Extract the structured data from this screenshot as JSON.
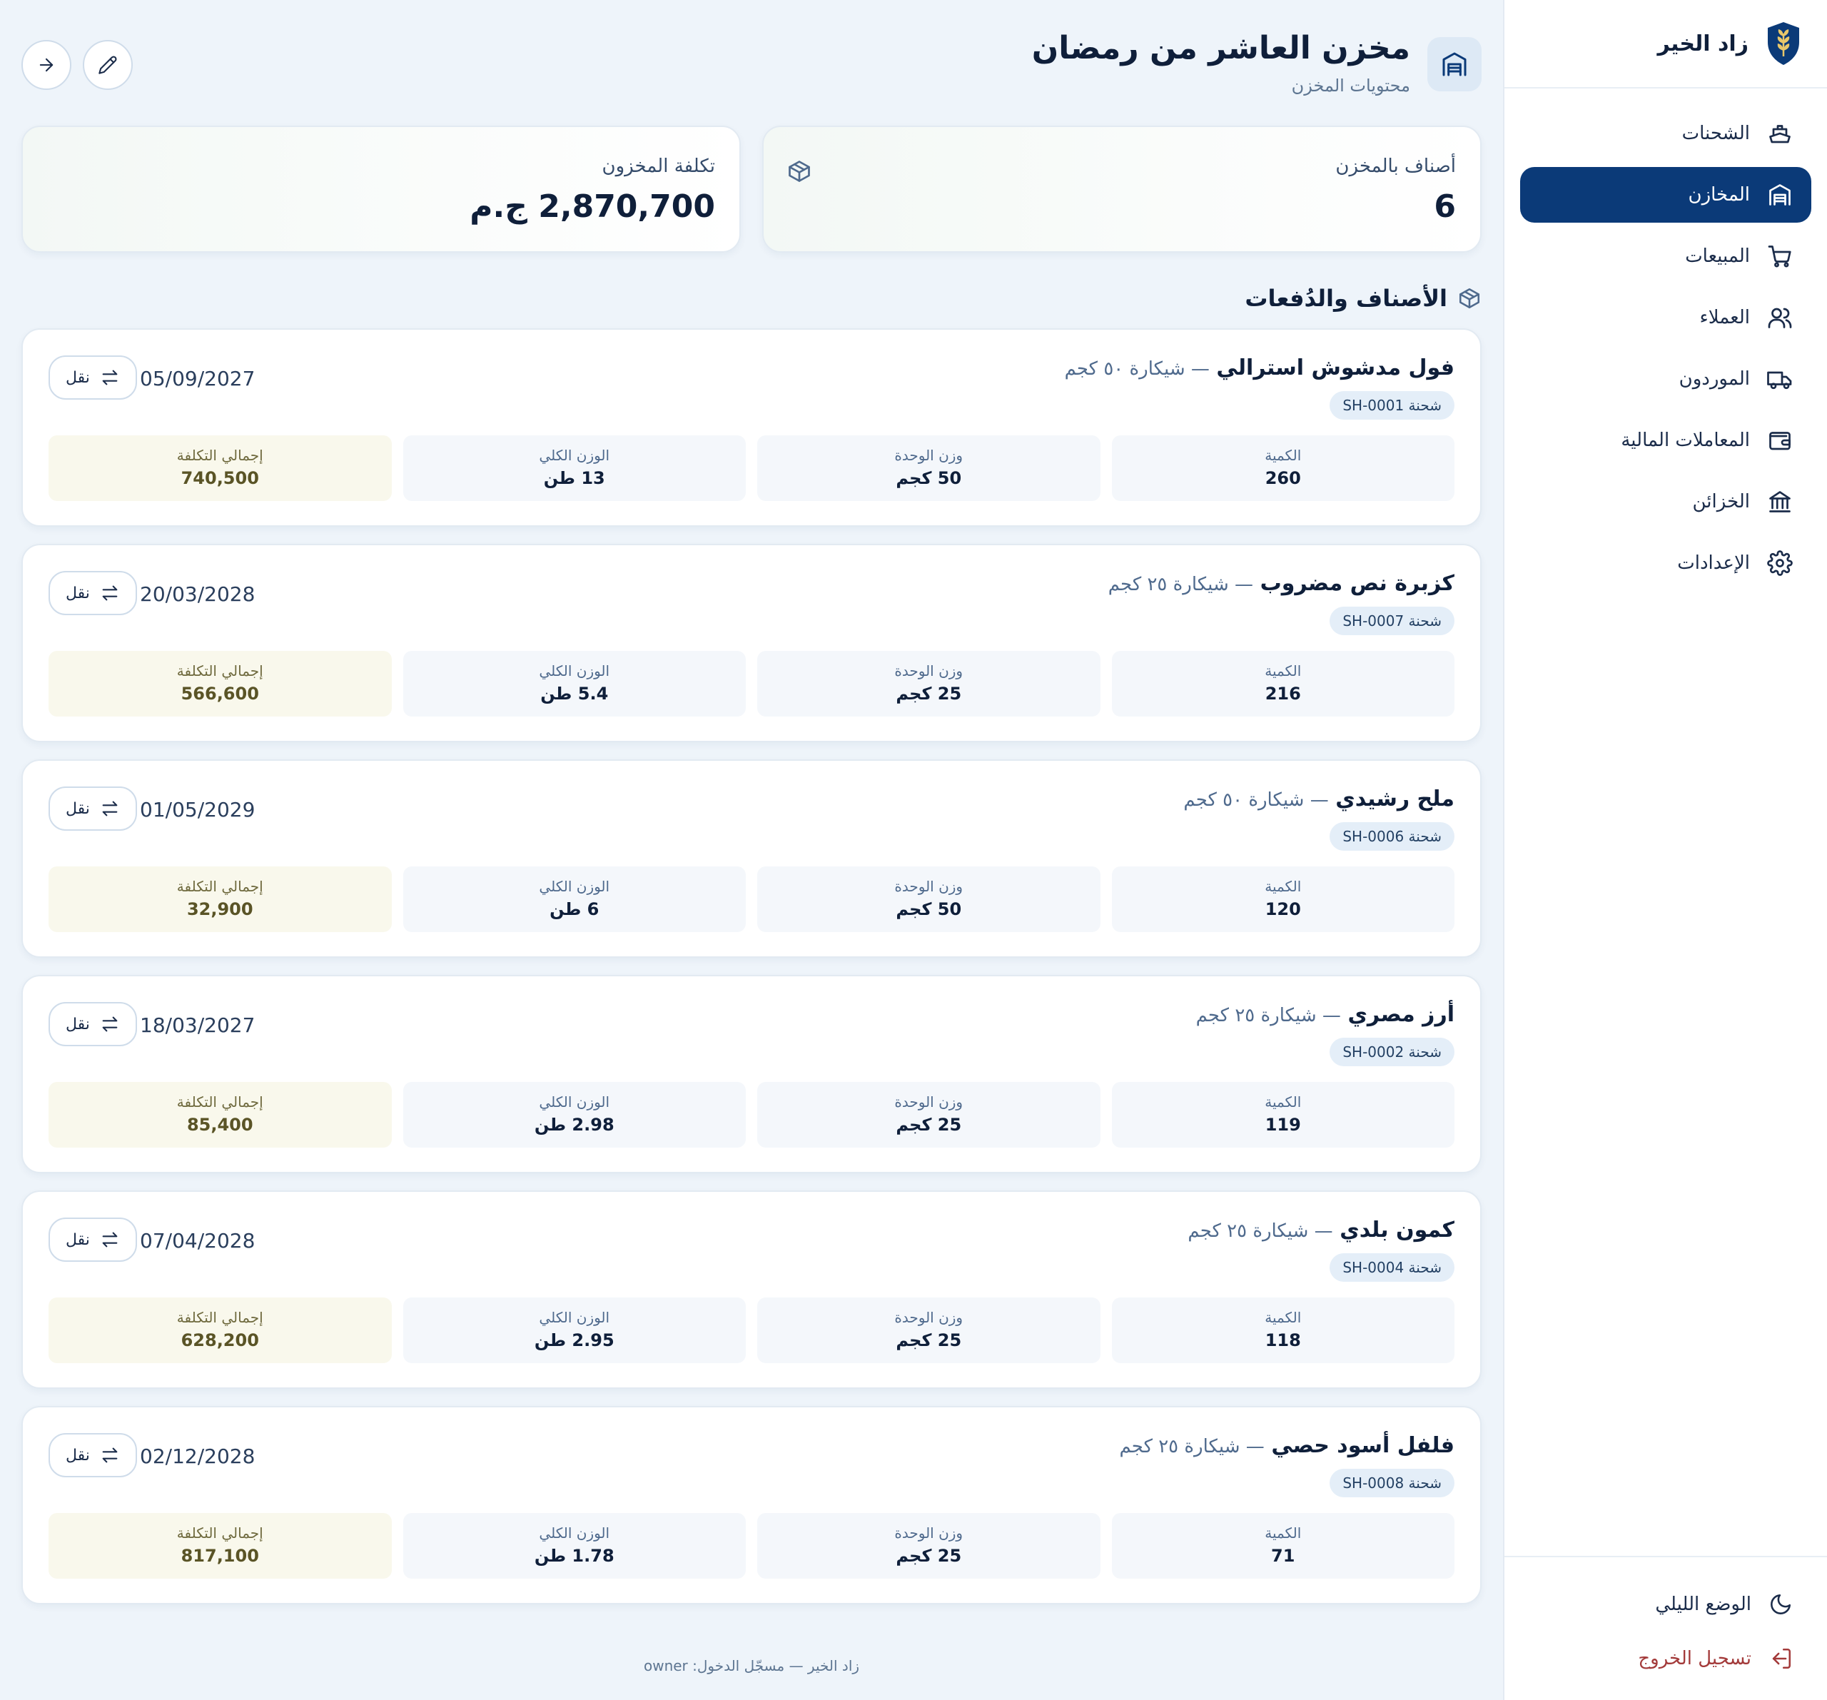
{
  "brand": {
    "name": "زاد الخير",
    "icon": "wheat-shield-icon"
  },
  "nav": [
    {
      "label": "الشحنات",
      "icon": "ship-icon",
      "active": false
    },
    {
      "label": "المخازن",
      "icon": "warehouse-icon",
      "active": true
    },
    {
      "label": "المبيعات",
      "icon": "cart-icon",
      "active": false
    },
    {
      "label": "العملاء",
      "icon": "users-icon",
      "active": false
    },
    {
      "label": "الموردون",
      "icon": "truck-icon",
      "active": false
    },
    {
      "label": "المعاملات المالية",
      "icon": "wallet-icon",
      "active": false
    },
    {
      "label": "الخزائن",
      "icon": "bank-icon",
      "active": false
    },
    {
      "label": "الإعدادات",
      "icon": "gear-icon",
      "active": false
    }
  ],
  "sidebar_bottom": {
    "dark_mode": "الوضع الليلي",
    "logout": "تسجيل الخروج"
  },
  "header": {
    "title": "مخزن العاشر من رمضان",
    "subtitle": "محتويات المخزن"
  },
  "stats": {
    "items_label": "أصناف بالمخزن",
    "items_value": "6",
    "cost_label": "تكلفة المخزون",
    "cost_value": "2,870,700 ج.م"
  },
  "section": {
    "title": "الأصناف والدُفعات"
  },
  "labels": {
    "quantity": "الكمية",
    "unit_weight": "وزن الوحدة",
    "total_weight": "الوزن الكلي",
    "total_cost": "إجمالي التكلفة",
    "move": "نقل"
  },
  "items": [
    {
      "name": "فول مدشوش استرالي",
      "package": "— شيكارة ٥٠ كجم",
      "shipment": "شحنة SH-0001",
      "date": "05/09/2027",
      "quantity": "260",
      "unit_weight": "50 كجم",
      "total_weight": "13 طن",
      "total_cost": "740,500"
    },
    {
      "name": "كزبرة نص مضروب",
      "package": "— شيكارة ٢٥ كجم",
      "shipment": "شحنة SH-0007",
      "date": "20/03/2028",
      "quantity": "216",
      "unit_weight": "25 كجم",
      "total_weight": "5.4 طن",
      "total_cost": "566,600"
    },
    {
      "name": "ملح رشيدي",
      "package": "— شيكارة ٥٠ كجم",
      "shipment": "شحنة SH-0006",
      "date": "01/05/2029",
      "quantity": "120",
      "unit_weight": "50 كجم",
      "total_weight": "6 طن",
      "total_cost": "32,900"
    },
    {
      "name": "أرز مصري",
      "package": "— شيكارة ٢٥ كجم",
      "shipment": "شحنة SH-0002",
      "date": "18/03/2027",
      "quantity": "119",
      "unit_weight": "25 كجم",
      "total_weight": "2.98 طن",
      "total_cost": "85,400"
    },
    {
      "name": "كمون بلدي",
      "package": "— شيكارة ٢٥ كجم",
      "shipment": "شحنة SH-0004",
      "date": "07/04/2028",
      "quantity": "118",
      "unit_weight": "25 كجم",
      "total_weight": "2.95 طن",
      "total_cost": "628,200"
    },
    {
      "name": "فلفل أسود حصي",
      "package": "— شيكارة ٢٥ كجم",
      "shipment": "شحنة SH-0008",
      "date": "02/12/2028",
      "quantity": "71",
      "unit_weight": "25 كجم",
      "total_weight": "1.78 طن",
      "total_cost": "817,100"
    }
  ],
  "footer": {
    "text": "زاد الخير — مسجّل الدخول: owner"
  },
  "colors": {
    "primary": "#0b3a78",
    "background": "#eef4fa",
    "logout": "#a33a3a",
    "cost_bg": "#f9f8ec"
  }
}
